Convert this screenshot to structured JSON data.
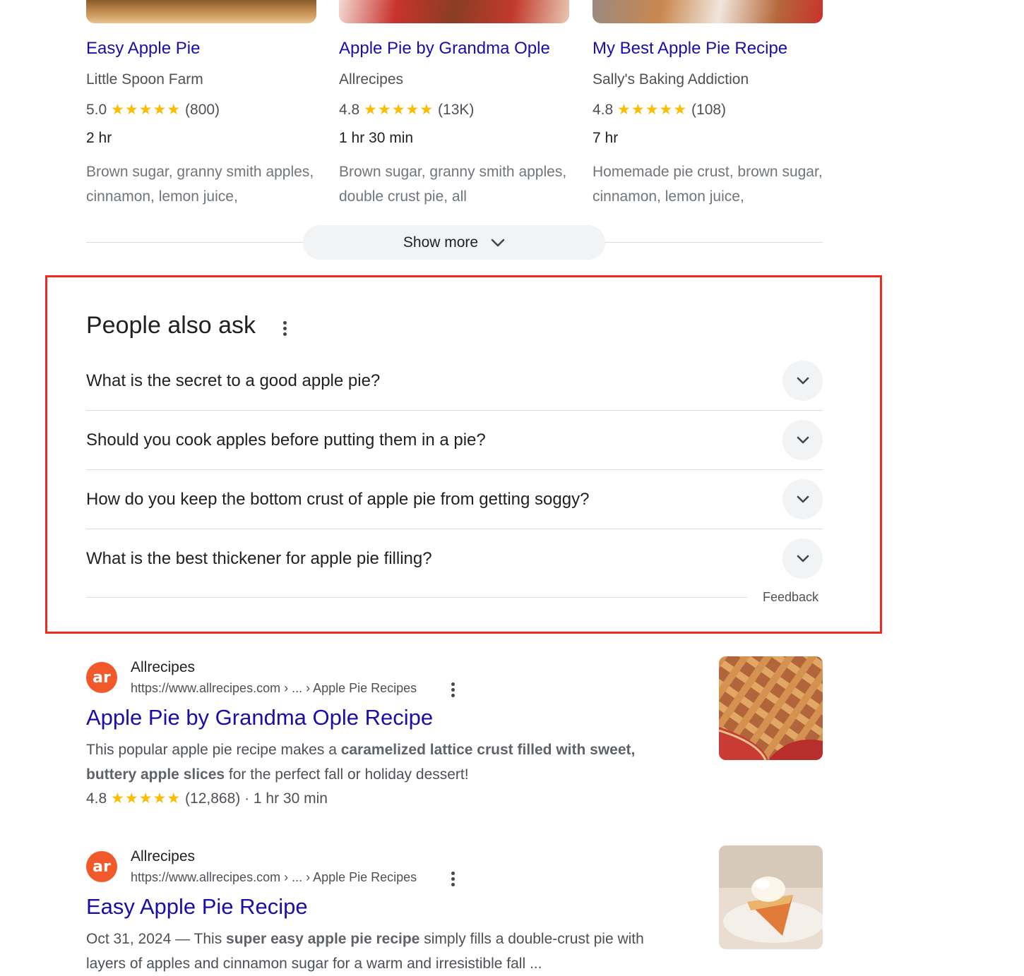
{
  "recipes": [
    {
      "title": "Easy Apple Pie",
      "source": "Little Spoon Farm",
      "rating": "5.0",
      "stars": "★★★★★",
      "reviews": "(800)",
      "time": "2 hr",
      "ingredients": "Brown sugar, granny smith apples, cinnamon, lemon juice,"
    },
    {
      "title": "Apple Pie by Grandma Ople",
      "source": "Allrecipes",
      "rating": "4.8",
      "stars": "★★★★★",
      "reviews": "(13K)",
      "time": "1 hr 30 min",
      "ingredients": "Brown sugar, granny smith apples, double crust pie, all"
    },
    {
      "title": "My Best Apple Pie Recipe",
      "source": "Sally's Baking Addiction",
      "rating": "4.8",
      "stars": "★★★★★",
      "reviews": "(108)",
      "time": "7 hr",
      "ingredients": "Homemade pie crust, brown sugar, cinnamon, lemon juice,"
    }
  ],
  "show_more": {
    "label": "Show more",
    "icon": "chevron-down-icon"
  },
  "paa": {
    "title": "People also ask",
    "questions": [
      "What is the secret to a good apple pie?",
      "Should you cook apples before putting them in a pie?",
      "How do you keep the bottom crust of apple pie from getting soggy?",
      "What is the best thickener for apple pie filling?"
    ],
    "feedback": "Feedback"
  },
  "results": [
    {
      "favicon": "ar",
      "site": "Allrecipes",
      "url": "https://www.allrecipes.com › ... › Apple Pie Recipes",
      "title": "Apple Pie by Grandma Ople Recipe",
      "snippet_pre": "This popular apple pie recipe makes a ",
      "snippet_bold": "caramelized lattice crust filled with sweet, buttery apple slices",
      "snippet_post": " for the perfect fall or holiday dessert!",
      "rating": "4.8",
      "stars": "★★★★★",
      "meta": "(12,868) · 1 hr 30 min"
    },
    {
      "favicon": "ar",
      "site": "Allrecipes",
      "url": "https://www.allrecipes.com › ... › Apple Pie Recipes",
      "title": "Easy Apple Pie Recipe",
      "snippet_pre": "Oct 31, 2024 — This ",
      "snippet_bold": "super easy apple pie recipe",
      "snippet_post": " simply fills a double-crust pie with layers of apples and cinnamon sugar for a warm and irresistible fall ..."
    }
  ],
  "colors": {
    "link": "#1a0dab",
    "highlight": "#f0281f",
    "star": "#fbbc04",
    "favicon": "#f1592a"
  }
}
